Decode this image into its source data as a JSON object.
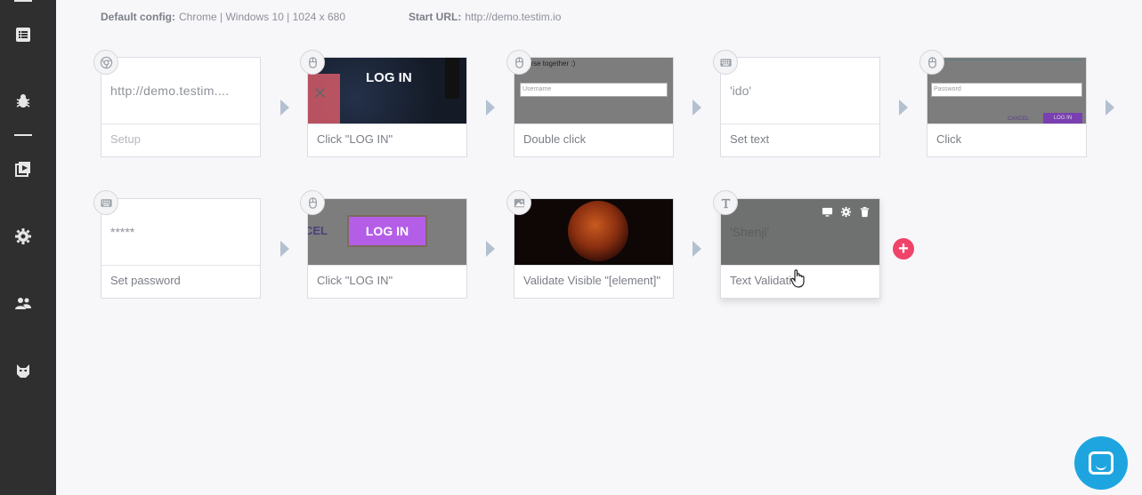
{
  "header": {
    "config_label": "Default config:",
    "config_value": "Chrome | Windows 10 | 1024 x 680",
    "start_label": "Start URL:",
    "start_value": "http://demo.testim.io"
  },
  "sidebar": {
    "items": [
      {
        "icon": "list-icon"
      },
      {
        "icon": "bug-icon"
      },
      {
        "icon": "playlist-icon"
      },
      {
        "icon": "gear-icon"
      },
      {
        "icon": "users-icon"
      },
      {
        "icon": "cat-mask-icon"
      }
    ]
  },
  "steps": [
    {
      "label": "Setup",
      "icon": "chrome-icon",
      "value": "http://demo.testim...."
    },
    {
      "label": "Click \"LOG IN\"",
      "icon": "mouse-icon",
      "thumb_text": "LOG IN"
    },
    {
      "label": "Double click",
      "icon": "mouse-icon",
      "thumb_text": "erse together :)",
      "thumb_field": "Username"
    },
    {
      "label": "Set text",
      "icon": "keyboard-icon",
      "value": "'ido'"
    },
    {
      "label": "Click",
      "icon": "mouse-icon",
      "thumb_field": "Password",
      "thumb_cancel": "CANCEL",
      "thumb_login": "LOG IN"
    },
    {
      "label": "Set password",
      "icon": "keyboard-icon",
      "value": "*****"
    },
    {
      "label": "Click \"LOG IN\"",
      "icon": "mouse-icon",
      "thumb_text": "LOG IN",
      "thumb_side": "CEL"
    },
    {
      "label": "Validate Visible \"[element]\"",
      "icon": "image-icon"
    },
    {
      "label": "Text Validation",
      "icon": "text-icon",
      "value": "'Shenji'"
    }
  ],
  "add_button": "+",
  "colors": {
    "accent": "#f0436a",
    "chat": "#1ea5e0",
    "sidebar": "#2f2f2f",
    "purple": "#b45ee8"
  }
}
